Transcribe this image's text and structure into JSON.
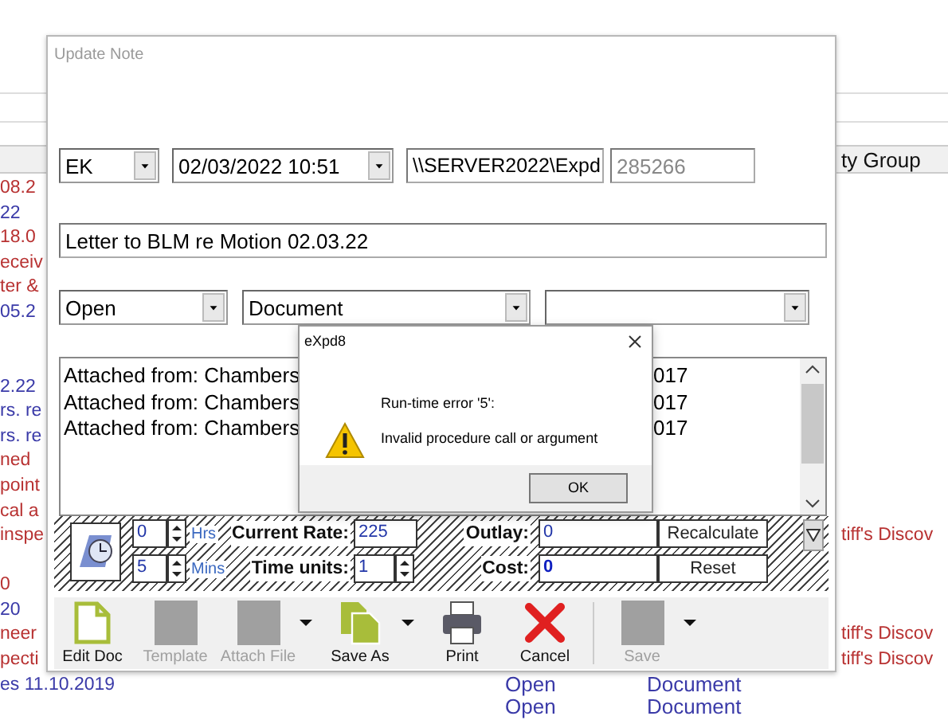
{
  "background_list": {
    "header": "ty Group",
    "rows": [
      {
        "column_1": "08.2",
        "color": "#b83232"
      },
      {
        "column_1": "22",
        "color": "#3a3aa8"
      },
      {
        "column_1": "18.0",
        "color": "#b83232"
      },
      {
        "column_1": "eceiv",
        "color": "#b83232"
      },
      {
        "column_1": "ter &",
        "color": "#b83232"
      },
      {
        "column_1": "05.2",
        "color": "#3a3aa8"
      },
      {},
      {},
      {
        "column_1": "2.22",
        "color": "#3a3aa8"
      },
      {
        "column_1": "rs. re",
        "color": "#3a3aa8"
      },
      {
        "column_1": "rs. re",
        "color": "#3a3aa8"
      },
      {
        "column_1": "ned",
        "color": "#b83232"
      },
      {
        "column_1": "point",
        "color": "#b83232"
      },
      {
        "column_1": "cal a",
        "color": "#b83232"
      },
      {
        "column_1": "inspe",
        "column_4": "tiff's Discov",
        "color": "#b83232"
      },
      {},
      {
        "column_1": "0",
        "color": "#b83232"
      },
      {
        "column_1": "20",
        "color": "#3a3aa8"
      },
      {
        "column_1": "neer",
        "column_4": "tiff's Discov",
        "color": "#b83232"
      },
      {
        "column_1": "pecti",
        "column_4": "tiff's Discov",
        "color": "#b83232"
      },
      {
        "column_1": "es 11.10.2019",
        "column_2": "Open",
        "column_3": "Document",
        "color": "#3a3aa8"
      },
      {
        "column_2": "Open",
        "column_3": "Document",
        "color": "#3a3aa8"
      }
    ]
  },
  "update_note": {
    "title": "Update Note",
    "author": "EK",
    "date": "02/03/2022 10:51",
    "path": "\\\\SERVER2022\\Expd",
    "number": "285266",
    "description": "Letter to BLM re Motion 02.03.22",
    "status": "Open",
    "type": "Document",
    "attachments": [
      {
        "start": "Attached from: Chambers",
        "end": "017"
      },
      {
        "start": "Attached from: Chambers",
        "end": "017"
      },
      {
        "start": "Attached from: Chambers",
        "end": "017"
      }
    ],
    "time": {
      "hours": "0",
      "hours_unit": "Hrs",
      "minutes": "5",
      "minutes_unit": "Mins",
      "rate_label": "Current Rate:",
      "rate": "225",
      "units_label": "Time units:",
      "units": "1",
      "outlay_label": "Outlay:",
      "outlay": "0",
      "cost_label": "Cost:",
      "cost": "0",
      "recalculate": "Recalculate",
      "reset": "Reset"
    },
    "toolbar": [
      {
        "label": "Edit Doc",
        "kind": "document",
        "disabled": false,
        "dropdown": false
      },
      {
        "label": "Template",
        "kind": "blank",
        "disabled": true,
        "dropdown": false
      },
      {
        "label": "Attach File",
        "kind": "blank",
        "disabled": true,
        "dropdown": true
      },
      {
        "label": "Save As",
        "kind": "copy",
        "disabled": false,
        "dropdown": true
      },
      {
        "label": "Print",
        "kind": "printer",
        "disabled": false,
        "dropdown": false
      },
      {
        "label": "Cancel",
        "kind": "cross",
        "disabled": false,
        "dropdown": false
      },
      {
        "kind": "separator"
      },
      {
        "label": "Save",
        "kind": "blank",
        "disabled": true,
        "dropdown": true
      }
    ]
  },
  "error_dialog": {
    "title": "eXpd8",
    "message": "Run-time error '5':",
    "detail": "Invalid procedure call or argument",
    "button": "OK"
  }
}
